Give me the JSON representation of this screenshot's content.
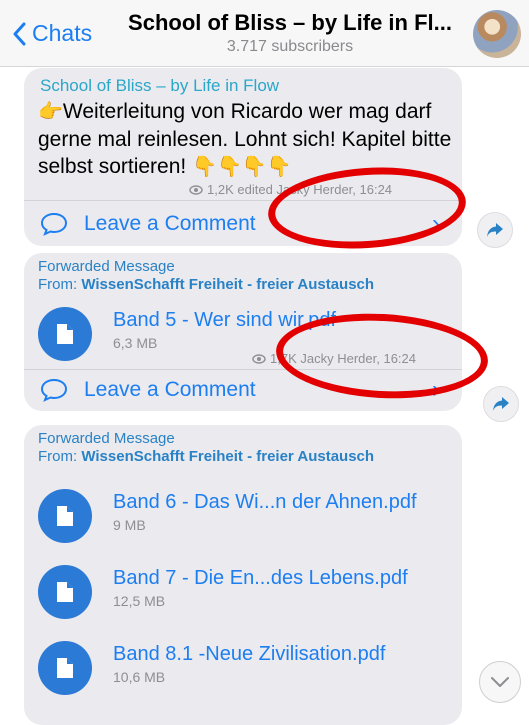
{
  "header": {
    "back_label": "Chats",
    "title": "School of Bliss – by Life in Fl...",
    "subtitle": "3.717 subscribers"
  },
  "messages": [
    {
      "sender": "School of Bliss – by Life in Flow",
      "emoji_lead": "👉",
      "text": "Weiterleitung von Ricardo wer mag darf gerne mal reinlesen. Lohnt sich! Kapitel bitte selbst sortieren!",
      "emoji_tail": "👇👇👇👇",
      "views": "1,2K",
      "edited": "edited",
      "author": "Jacky Herder, 16:24",
      "comment_label": "Leave a Comment",
      "chevron": "›"
    },
    {
      "forward_label": "Forwarded Message",
      "from_prefix": "From:",
      "from_name": "WissenSchafft Freiheit - freier Austausch",
      "file": {
        "name": "Band 5 - Wer sind wir.pdf",
        "size": "6,3 MB"
      },
      "views": "1,7K",
      "author": "Jacky Herder, 16:24",
      "comment_label": "Leave a Comment",
      "chevron": "›"
    },
    {
      "forward_label": "Forwarded Message",
      "from_prefix": "From:",
      "from_name": "WissenSchafft Freiheit - freier Austausch",
      "files": [
        {
          "name": "Band 6 - Das Wi...n der Ahnen.pdf",
          "size": "9 MB"
        },
        {
          "name": "Band 7 - Die En...des Lebens.pdf",
          "size": "12,5 MB"
        },
        {
          "name": "Band 8.1 -Neue Zivilisation.pdf",
          "size": "10,6 MB"
        }
      ]
    }
  ],
  "colors": {
    "accent": "#1c7ef0",
    "sender": "#2aa7c9",
    "file_icon": "#2a7ad6",
    "annotation": "#e30000"
  },
  "icons": {
    "back": "chevron-left-icon",
    "views": "eye-icon",
    "comment": "speech-bubble-icon",
    "share": "share-arrow-icon",
    "file": "document-icon",
    "scroll": "chevron-down-icon"
  }
}
